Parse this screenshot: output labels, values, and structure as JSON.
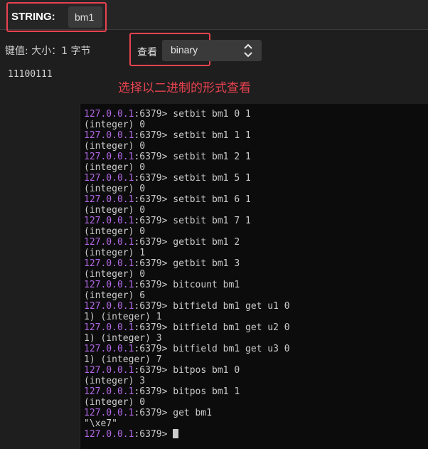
{
  "header": {
    "type_label": "STRING:",
    "key_name": "bm1"
  },
  "meta": {
    "text": "键值: 大小：1 字节"
  },
  "view": {
    "label": "查看",
    "selected": "binary"
  },
  "value": {
    "binary": "11100111"
  },
  "annotation": {
    "text": "选择以二进制的形式查看"
  },
  "terminal": {
    "lines": [
      {
        "prompt": "127.0.0.1",
        "rest": ":6379> setbit bm1 0 1"
      },
      {
        "text": "(integer) 0"
      },
      {
        "prompt": "127.0.0.1",
        "rest": ":6379> setbit bm1 1 1"
      },
      {
        "text": "(integer) 0"
      },
      {
        "prompt": "127.0.0.1",
        "rest": ":6379> setbit bm1 2 1"
      },
      {
        "text": "(integer) 0"
      },
      {
        "prompt": "127.0.0.1",
        "rest": ":6379> setbit bm1 5 1"
      },
      {
        "text": "(integer) 0"
      },
      {
        "prompt": "127.0.0.1",
        "rest": ":6379> setbit bm1 6 1"
      },
      {
        "text": "(integer) 0"
      },
      {
        "prompt": "127.0.0.1",
        "rest": ":6379> setbit bm1 7 1"
      },
      {
        "text": "(integer) 0"
      },
      {
        "prompt": "127.0.0.1",
        "rest": ":6379> getbit bm1 2"
      },
      {
        "text": "(integer) 1"
      },
      {
        "prompt": "127.0.0.1",
        "rest": ":6379> getbit bm1 3"
      },
      {
        "text": "(integer) 0"
      },
      {
        "prompt": "127.0.0.1",
        "rest": ":6379> bitcount bm1"
      },
      {
        "text": "(integer) 6"
      },
      {
        "prompt": "127.0.0.1",
        "rest": ":6379> bitfield bm1 get u1 0"
      },
      {
        "text": "1) (integer) 1"
      },
      {
        "prompt": "127.0.0.1",
        "rest": ":6379> bitfield bm1 get u2 0"
      },
      {
        "text": "1) (integer) 3"
      },
      {
        "prompt": "127.0.0.1",
        "rest": ":6379> bitfield bm1 get u3 0"
      },
      {
        "text": "1) (integer) 7"
      },
      {
        "prompt": "127.0.0.1",
        "rest": ":6379> bitpos bm1 0"
      },
      {
        "text": "(integer) 3"
      },
      {
        "prompt": "127.0.0.1",
        "rest": ":6379> bitpos bm1 1"
      },
      {
        "text": "(integer) 0"
      },
      {
        "prompt": "127.0.0.1",
        "rest": ":6379> get bm1"
      },
      {
        "text": "\"\\xe7\""
      },
      {
        "prompt": "127.0.0.1",
        "rest": ":6379> ",
        "cursor": true
      }
    ]
  },
  "colors": {
    "highlight_border": "#e8424f",
    "prompt_ip": "#b267e6"
  }
}
